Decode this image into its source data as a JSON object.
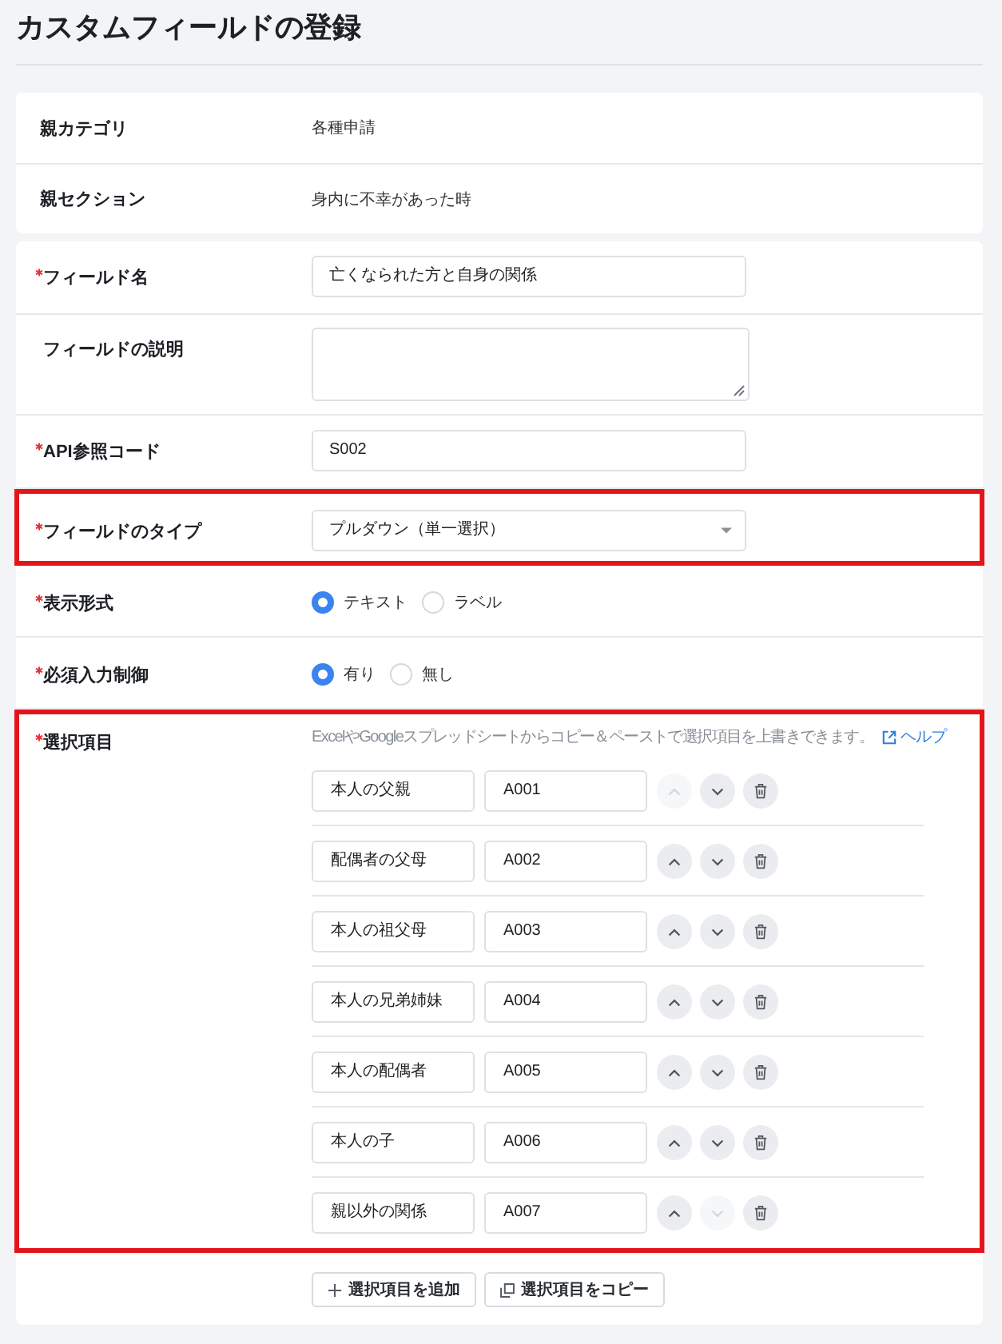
{
  "page": {
    "title": "カスタムフィールドの登録"
  },
  "parent_info": [
    {
      "label": "親カテゴリ",
      "value": "各種申請"
    },
    {
      "label": "親セクション",
      "value": "身内に不幸があった時"
    }
  ],
  "fields": [
    {
      "kind": "text",
      "label": "フィールド名",
      "required": true,
      "highlighted": false,
      "value": "亡くなられた方と自身の関係"
    },
    {
      "kind": "textarea",
      "label": "フィールドの説明",
      "required": false,
      "highlighted": false
    },
    {
      "kind": "text",
      "label": "API参照コード",
      "required": true,
      "highlighted": false,
      "value": "S002"
    },
    {
      "kind": "select",
      "label": "フィールドのタイプ",
      "required": true,
      "highlighted": true,
      "value": "プルダウン（単一選択）"
    },
    {
      "kind": "radio",
      "label": "表示形式",
      "required": true,
      "highlighted": false,
      "options": [
        {
          "label": "テキスト",
          "selected": true
        },
        {
          "label": "ラベル",
          "selected": false
        }
      ]
    },
    {
      "kind": "radio",
      "label": "必須入力制御",
      "required": true,
      "highlighted": false,
      "options": [
        {
          "label": "有り",
          "selected": true
        },
        {
          "label": "無し",
          "selected": false
        }
      ]
    },
    {
      "kind": "choices",
      "label": "選択項目",
      "required": true,
      "highlighted": true,
      "hint": "ExcelやGoogleスプレッドシートからコピー＆ペーストで選択項目を上書きできます。",
      "help_link": "ヘルプ",
      "items": [
        {
          "name": "本人の父親",
          "code": "A001",
          "up_disabled": true,
          "down_disabled": false
        },
        {
          "name": "配偶者の父母",
          "code": "A002",
          "up_disabled": false,
          "down_disabled": false
        },
        {
          "name": "本人の祖父母",
          "code": "A003",
          "up_disabled": false,
          "down_disabled": false
        },
        {
          "name": "本人の兄弟姉妹",
          "code": "A004",
          "up_disabled": false,
          "down_disabled": false
        },
        {
          "name": "本人の配偶者",
          "code": "A005",
          "up_disabled": false,
          "down_disabled": false
        },
        {
          "name": "本人の子",
          "code": "A006",
          "up_disabled": false,
          "down_disabled": false
        },
        {
          "name": "親以外の関係",
          "code": "A007",
          "up_disabled": false,
          "down_disabled": true
        }
      ]
    }
  ],
  "actions": [
    {
      "kind": "add",
      "label": "選択項目を追加"
    },
    {
      "kind": "copy",
      "label": "選択項目をコピー"
    }
  ]
}
